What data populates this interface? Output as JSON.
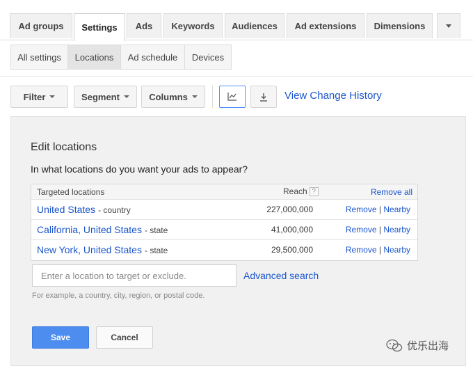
{
  "tabs": [
    {
      "label": "Ad groups",
      "active": false
    },
    {
      "label": "Settings",
      "active": true
    },
    {
      "label": "Ads",
      "active": false
    },
    {
      "label": "Keywords",
      "active": false
    },
    {
      "label": "Audiences",
      "active": false
    },
    {
      "label": "Ad extensions",
      "active": false
    },
    {
      "label": "Dimensions",
      "active": false
    }
  ],
  "more_tabs_icon": "chevron-down-icon",
  "subtabs": [
    {
      "label": "All settings",
      "active": false
    },
    {
      "label": "Locations",
      "active": true
    },
    {
      "label": "Ad schedule",
      "active": false
    },
    {
      "label": "Devices",
      "active": false
    }
  ],
  "toolbar": {
    "filter_label": "Filter",
    "segment_label": "Segment",
    "columns_label": "Columns",
    "chart_icon": "line-chart-icon",
    "download_icon": "download-icon",
    "history_label": "View Change History"
  },
  "edit_locations": {
    "title": "Edit locations",
    "question": "In what locations do you want your ads to appear?",
    "table": {
      "col_location": "Targeted locations",
      "col_reach": "Reach",
      "help_icon": "?",
      "remove_all": "Remove all",
      "rows": [
        {
          "name": "United States",
          "type": "- country",
          "reach": "227,000,000",
          "remove": "Remove",
          "sep": "|",
          "nearby": "Nearby"
        },
        {
          "name": "California, United States",
          "type": "- state",
          "reach": "41,000,000",
          "remove": "Remove",
          "sep": "|",
          "nearby": "Nearby"
        },
        {
          "name": "New York, United States",
          "type": "- state",
          "reach": "29,500,000",
          "remove": "Remove",
          "sep": "|",
          "nearby": "Nearby"
        }
      ]
    },
    "input_placeholder": "Enter a location to target or exclude.",
    "advanced_search": "Advanced search",
    "hint": "For example, a country, city, region, or postal code.",
    "save_label": "Save",
    "cancel_label": "Cancel"
  },
  "watermark": {
    "text": "优乐出海",
    "icon": "wechat-icon"
  },
  "colors": {
    "link": "#1a55cc",
    "primary_button": "#4d8df0",
    "panel_bg": "#f1f1f1"
  }
}
